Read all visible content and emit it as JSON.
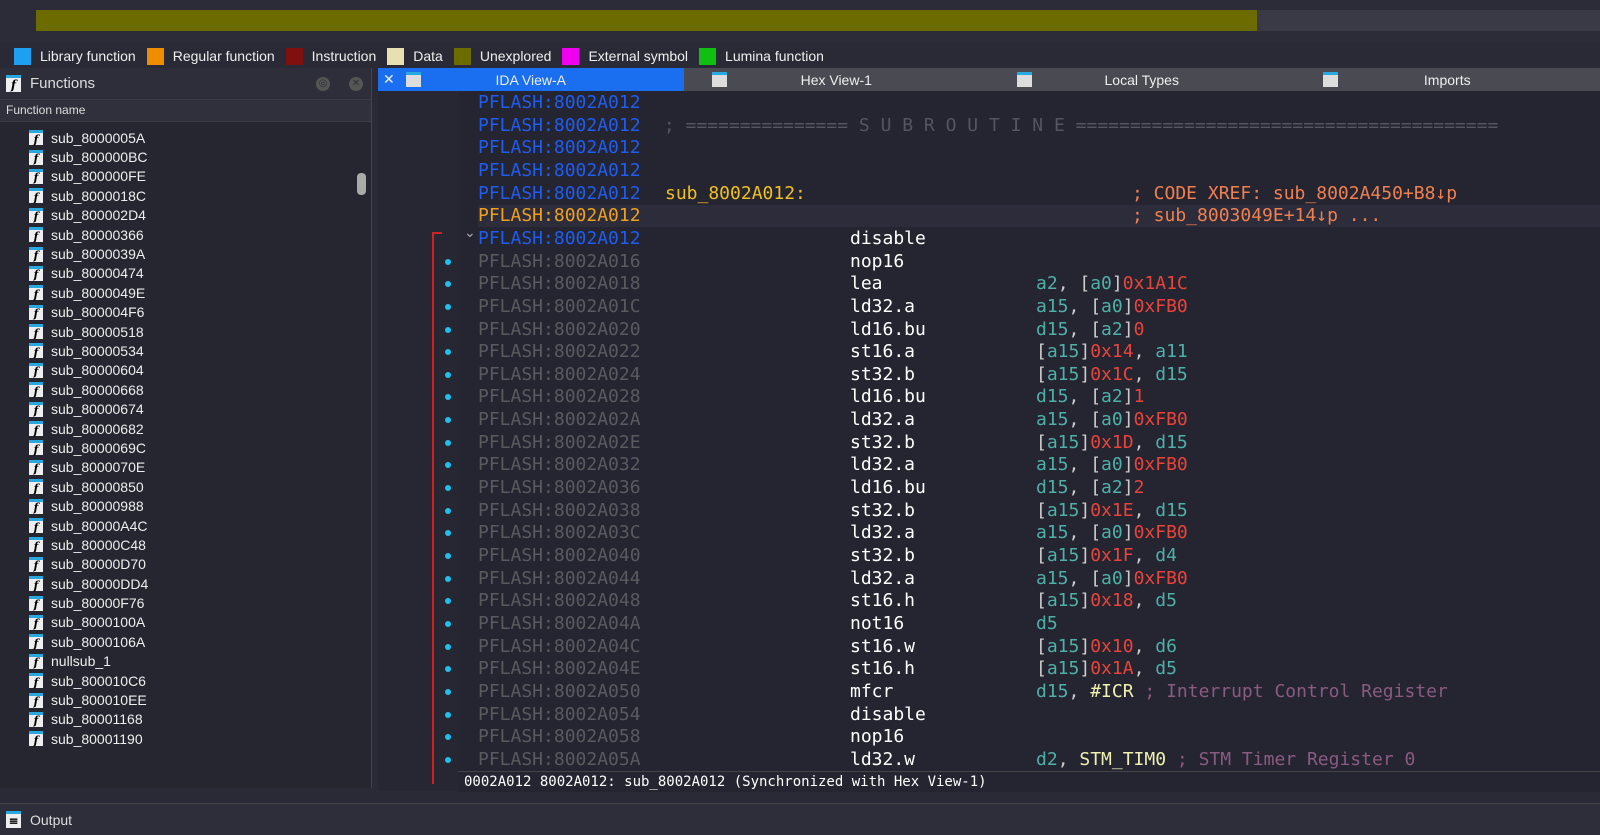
{
  "navigator": {
    "explored_fraction": 0.78,
    "colors": {
      "unexplored": "#6b6b00"
    }
  },
  "legend": [
    {
      "label": "Library function",
      "color": "#1ea0f0"
    },
    {
      "label": "Regular function",
      "color": "#f08c00"
    },
    {
      "label": "Instruction",
      "color": "#801010"
    },
    {
      "label": "Data",
      "color": "#e8e0b0"
    },
    {
      "label": "Unexplored",
      "color": "#6b6b00"
    },
    {
      "label": "External symbol",
      "color": "#f000f0"
    },
    {
      "label": "Lumina function",
      "color": "#10c010"
    }
  ],
  "functions": {
    "title": "Functions",
    "column": "Function name",
    "items": [
      "sub_8000005A",
      "sub_800000BC",
      "sub_800000FE",
      "sub_8000018C",
      "sub_800002D4",
      "sub_80000366",
      "sub_8000039A",
      "sub_80000474",
      "sub_8000049E",
      "sub_800004F6",
      "sub_80000518",
      "sub_80000534",
      "sub_80000604",
      "sub_80000668",
      "sub_80000674",
      "sub_80000682",
      "sub_8000069C",
      "sub_8000070E",
      "sub_80000850",
      "sub_80000988",
      "sub_80000A4C",
      "sub_80000C48",
      "sub_80000D70",
      "sub_80000DD4",
      "sub_80000F76",
      "sub_8000100A",
      "sub_8000106A",
      "nullsub_1",
      "sub_800010C6",
      "sub_800010EE",
      "sub_80001168",
      "sub_80001190"
    ]
  },
  "tabs": [
    {
      "label": "IDA View-A",
      "active": true
    },
    {
      "label": "Hex View-1"
    },
    {
      "label": "Local Types"
    },
    {
      "label": "Imports"
    }
  ],
  "code": [
    {
      "addr": "PFLASH:8002A012",
      "style": "blue"
    },
    {
      "addr": "PFLASH:8002A012",
      "style": "blue",
      "rest": [
        [
          "c",
          " ; =============== S U B R O U T I N E ======================================="
        ]
      ]
    },
    {
      "addr": "PFLASH:8002A012",
      "style": "blue"
    },
    {
      "addr": "PFLASH:8002A012",
      "style": "blue"
    },
    {
      "addr": "PFLASH:8002A012",
      "style": "blue",
      "label": "sub_8002A012:",
      "xref": "; CODE XREF: sub_8002A450+B8↓p"
    },
    {
      "addr": "PFLASH:8002A012",
      "style": "orange",
      "current": true,
      "xref": "; sub_8003049E+14↓p ..."
    },
    {
      "addr": "PFLASH:8002A012",
      "style": "blue",
      "mn": "disable"
    },
    {
      "addr": "PFLASH:8002A016",
      "mn": "nop16"
    },
    {
      "addr": "PFLASH:8002A018",
      "mn": "lea",
      "ops": [
        [
          "r",
          "a2"
        ],
        [
          "p",
          ", ["
        ],
        [
          "r",
          "a0"
        ],
        [
          "p",
          "]"
        ],
        [
          "n",
          "0x1A1C"
        ]
      ]
    },
    {
      "addr": "PFLASH:8002A01C",
      "mn": "ld32.a",
      "ops": [
        [
          "r",
          "a15"
        ],
        [
          "p",
          ", ["
        ],
        [
          "r",
          "a0"
        ],
        [
          "p",
          "]"
        ],
        [
          "n",
          "0xFB0"
        ]
      ]
    },
    {
      "addr": "PFLASH:8002A020",
      "mn": "ld16.bu",
      "ops": [
        [
          "r",
          "d15"
        ],
        [
          "p",
          ", ["
        ],
        [
          "r",
          "a2"
        ],
        [
          "p",
          "]"
        ],
        [
          "n",
          "0"
        ]
      ]
    },
    {
      "addr": "PFLASH:8002A022",
      "mn": "st16.a",
      "ops": [
        [
          "p",
          "["
        ],
        [
          "r",
          "a15"
        ],
        [
          "p",
          "]"
        ],
        [
          "n",
          "0x14"
        ],
        [
          "p",
          ", "
        ],
        [
          "r",
          "a11"
        ]
      ]
    },
    {
      "addr": "PFLASH:8002A024",
      "mn": "st32.b",
      "ops": [
        [
          "p",
          "["
        ],
        [
          "r",
          "a15"
        ],
        [
          "p",
          "]"
        ],
        [
          "n",
          "0x1C"
        ],
        [
          "p",
          ", "
        ],
        [
          "r",
          "d15"
        ]
      ]
    },
    {
      "addr": "PFLASH:8002A028",
      "mn": "ld16.bu",
      "ops": [
        [
          "r",
          "d15"
        ],
        [
          "p",
          ", ["
        ],
        [
          "r",
          "a2"
        ],
        [
          "p",
          "]"
        ],
        [
          "n",
          "1"
        ]
      ]
    },
    {
      "addr": "PFLASH:8002A02A",
      "mn": "ld32.a",
      "ops": [
        [
          "r",
          "a15"
        ],
        [
          "p",
          ", ["
        ],
        [
          "r",
          "a0"
        ],
        [
          "p",
          "]"
        ],
        [
          "n",
          "0xFB0"
        ]
      ]
    },
    {
      "addr": "PFLASH:8002A02E",
      "mn": "st32.b",
      "ops": [
        [
          "p",
          "["
        ],
        [
          "r",
          "a15"
        ],
        [
          "p",
          "]"
        ],
        [
          "n",
          "0x1D"
        ],
        [
          "p",
          ", "
        ],
        [
          "r",
          "d15"
        ]
      ]
    },
    {
      "addr": "PFLASH:8002A032",
      "mn": "ld32.a",
      "ops": [
        [
          "r",
          "a15"
        ],
        [
          "p",
          ", ["
        ],
        [
          "r",
          "a0"
        ],
        [
          "p",
          "]"
        ],
        [
          "n",
          "0xFB0"
        ]
      ]
    },
    {
      "addr": "PFLASH:8002A036",
      "mn": "ld16.bu",
      "ops": [
        [
          "r",
          "d15"
        ],
        [
          "p",
          ", ["
        ],
        [
          "r",
          "a2"
        ],
        [
          "p",
          "]"
        ],
        [
          "n",
          "2"
        ]
      ]
    },
    {
      "addr": "PFLASH:8002A038",
      "mn": "st32.b",
      "ops": [
        [
          "p",
          "["
        ],
        [
          "r",
          "a15"
        ],
        [
          "p",
          "]"
        ],
        [
          "n",
          "0x1E"
        ],
        [
          "p",
          ", "
        ],
        [
          "r",
          "d15"
        ]
      ]
    },
    {
      "addr": "PFLASH:8002A03C",
      "mn": "ld32.a",
      "ops": [
        [
          "r",
          "a15"
        ],
        [
          "p",
          ", ["
        ],
        [
          "r",
          "a0"
        ],
        [
          "p",
          "]"
        ],
        [
          "n",
          "0xFB0"
        ]
      ]
    },
    {
      "addr": "PFLASH:8002A040",
      "mn": "st32.b",
      "ops": [
        [
          "p",
          "["
        ],
        [
          "r",
          "a15"
        ],
        [
          "p",
          "]"
        ],
        [
          "n",
          "0x1F"
        ],
        [
          "p",
          ", "
        ],
        [
          "r",
          "d4"
        ]
      ]
    },
    {
      "addr": "PFLASH:8002A044",
      "mn": "ld32.a",
      "ops": [
        [
          "r",
          "a15"
        ],
        [
          "p",
          ", ["
        ],
        [
          "r",
          "a0"
        ],
        [
          "p",
          "]"
        ],
        [
          "n",
          "0xFB0"
        ]
      ]
    },
    {
      "addr": "PFLASH:8002A048",
      "mn": "st16.h",
      "ops": [
        [
          "p",
          "["
        ],
        [
          "r",
          "a15"
        ],
        [
          "p",
          "]"
        ],
        [
          "n",
          "0x18"
        ],
        [
          "p",
          ", "
        ],
        [
          "r",
          "d5"
        ]
      ]
    },
    {
      "addr": "PFLASH:8002A04A",
      "mn": "not16",
      "ops": [
        [
          "r",
          "d5"
        ]
      ]
    },
    {
      "addr": "PFLASH:8002A04C",
      "mn": "st16.w",
      "ops": [
        [
          "p",
          "["
        ],
        [
          "r",
          "a15"
        ],
        [
          "p",
          "]"
        ],
        [
          "n",
          "0x10"
        ],
        [
          "p",
          ", "
        ],
        [
          "r",
          "d6"
        ]
      ]
    },
    {
      "addr": "PFLASH:8002A04E",
      "mn": "st16.h",
      "ops": [
        [
          "p",
          "["
        ],
        [
          "r",
          "a15"
        ],
        [
          "p",
          "]"
        ],
        [
          "n",
          "0x1A"
        ],
        [
          "p",
          ", "
        ],
        [
          "r",
          "d5"
        ]
      ]
    },
    {
      "addr": "PFLASH:8002A050",
      "mn": "mfcr",
      "ops": [
        [
          "r",
          "d15"
        ],
        [
          "p",
          ", "
        ],
        [
          "s",
          "#ICR"
        ],
        [
          "c",
          " ; Interrupt Control Register"
        ]
      ]
    },
    {
      "addr": "PFLASH:8002A054",
      "mn": "disable"
    },
    {
      "addr": "PFLASH:8002A058",
      "mn": "nop16"
    },
    {
      "addr": "PFLASH:8002A05A",
      "mn": "ld32.w",
      "ops": [
        [
          "r",
          "d2"
        ],
        [
          "p",
          ", "
        ],
        [
          "s",
          "STM_TIM0"
        ],
        [
          "c",
          " ; STM Timer Register 0"
        ]
      ]
    }
  ],
  "status": "0002A012 8002A012: sub_8002A012 (Synchronized with Hex View-1)",
  "output": {
    "title": "Output"
  }
}
